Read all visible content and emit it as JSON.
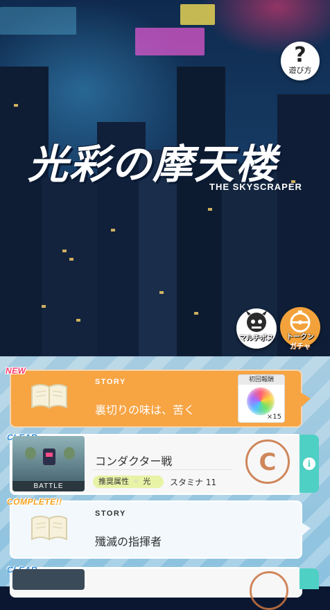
{
  "help": {
    "glyph": "?",
    "label": "遊び方"
  },
  "logo": {
    "title_jp": "光彩の摩天楼",
    "title_en": "THE SKYSCRAPER"
  },
  "buttons": {
    "multi_boss": "マルチボス",
    "token_gacha_line1": "トークン",
    "token_gacha_line2": "ガチャ"
  },
  "quests": [
    {
      "tag": "NEW",
      "type_label": "STORY",
      "title": "裏切りの味は、苦く",
      "reward": {
        "header": "初回報酬",
        "quantity": "×15"
      }
    },
    {
      "tag": "CLEAR",
      "thumb_label": "BATTLE",
      "title": "コンダクター戦",
      "attr_label": "推奨属性",
      "attr_star": "✧",
      "attr_value": "光",
      "stamina": "スタミナ 11",
      "stamp": "C",
      "info": "i"
    },
    {
      "tag": "COMPLETE!!",
      "type_label": "STORY",
      "title": "殲滅の指揮者"
    },
    {
      "tag": "CLEAR"
    }
  ],
  "colors": {
    "accent_orange": "#f7a443",
    "info_teal": "#4fd0c4",
    "new_pink": "#ff3d6c",
    "clear_blue": "#2c8bd8"
  }
}
